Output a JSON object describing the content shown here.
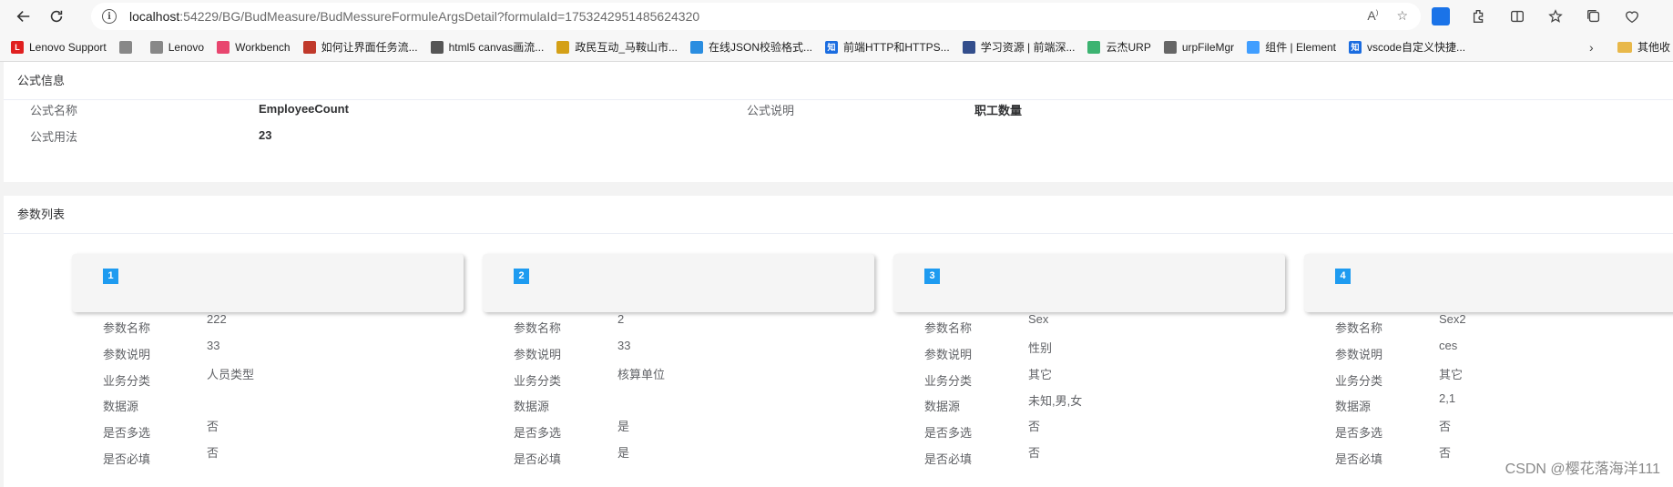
{
  "browser": {
    "url_host": "localhost",
    "url_path": ":54229/BG/BudMeasure/BudMessureFormuleArgsDetail?formulaId=1753242951485624320",
    "bookmarks": [
      {
        "label": "Lenovo Support",
        "color": "#e02020",
        "glyph": "L"
      },
      {
        "label": "",
        "color": "#888888",
        "glyph": ""
      },
      {
        "label": "Lenovo",
        "color": "#888888",
        "glyph": ""
      },
      {
        "label": "Workbench",
        "color": "#e8466f",
        "glyph": ""
      },
      {
        "label": "如何让界面任务流...",
        "color": "#c0392b",
        "glyph": ""
      },
      {
        "label": "html5 canvas画流...",
        "color": "#555555",
        "glyph": ""
      },
      {
        "label": "政民互动_马鞍山市...",
        "color": "#d4a017",
        "glyph": ""
      },
      {
        "label": "在线JSON校验格式...",
        "color": "#2a8de0",
        "glyph": ""
      },
      {
        "label": "前端HTTP和HTTPS...",
        "color": "#1a6ce0",
        "glyph": "知"
      },
      {
        "label": "学习资源 | 前端深...",
        "color": "#334e8c",
        "glyph": ""
      },
      {
        "label": "云杰URP",
        "color": "#3cb371",
        "glyph": ""
      },
      {
        "label": "urpFileMgr",
        "color": "#666666",
        "glyph": ""
      },
      {
        "label": "组件 | Element",
        "color": "#409eff",
        "glyph": ""
      },
      {
        "label": "vscode自定义快捷...",
        "color": "#1a6ce0",
        "glyph": "知"
      }
    ],
    "bookmark_folder": "其他收"
  },
  "formula_info": {
    "section_title": "公式信息",
    "name_label": "公式名称",
    "name_value": "EmployeeCount",
    "desc_label": "公式说明",
    "desc_value": "职工数量",
    "usage_label": "公式用法",
    "usage_value": "23"
  },
  "params": {
    "section_title": "参数列表",
    "labels": [
      "参数名称",
      "参数说明",
      "业务分类",
      "数据源",
      "是否多选",
      "是否必填"
    ],
    "items": [
      {
        "index": "1",
        "name": "222",
        "desc": "33",
        "category": "人员类型",
        "source": "",
        "multi": "否",
        "required": "否"
      },
      {
        "index": "2",
        "name": "2",
        "desc": "33",
        "category": "核算单位",
        "source": "",
        "multi": "是",
        "required": "是"
      },
      {
        "index": "3",
        "name": "Sex",
        "desc": "性别",
        "category": "其它",
        "source": "未知,男,女",
        "multi": "否",
        "required": "否"
      },
      {
        "index": "4",
        "name": "Sex2",
        "desc": "ces",
        "category": "其它",
        "source": "2,1",
        "multi": "否",
        "required": "否"
      }
    ]
  },
  "watermark": "CSDN @樱花落海洋111"
}
